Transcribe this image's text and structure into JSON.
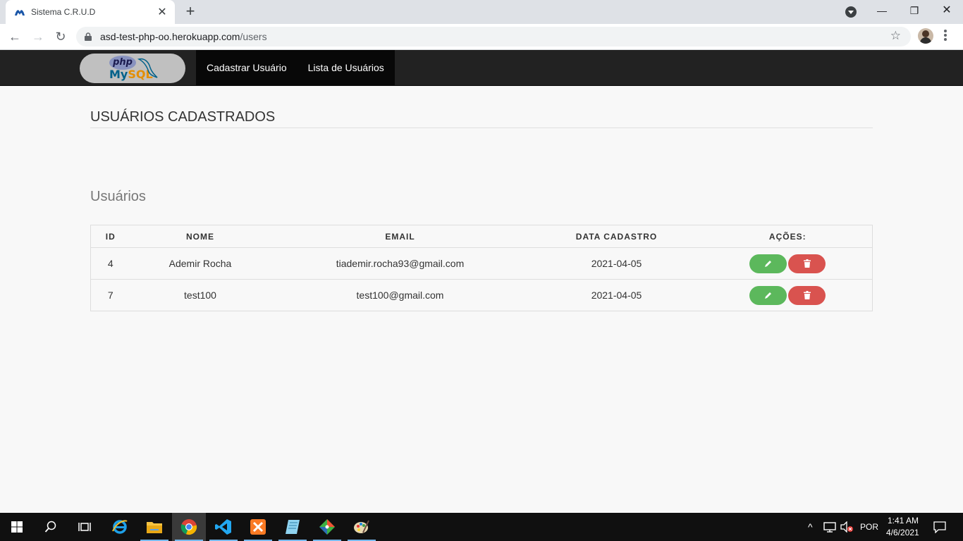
{
  "browser": {
    "tab_title": "Sistema C.R.U.D",
    "url_host": "asd-test-php-oo.herokuapp.com",
    "url_path": "/users"
  },
  "navbar": {
    "logo_php": "php",
    "logo_my": "My",
    "logo_sql": "SQL",
    "links": [
      "Cadastrar Usuário",
      "Lista de Usuários"
    ]
  },
  "page": {
    "header": "USUÁRIOS CADASTRADOS",
    "section_title": "Usuários"
  },
  "table": {
    "columns": [
      "ID",
      "NOME",
      "EMAIL",
      "DATA CADASTRO",
      "AÇÕES:"
    ],
    "rows": [
      {
        "id": "4",
        "nome": "Ademir Rocha",
        "email": "tiademir.rocha93@gmail.com",
        "data": "2021-04-05"
      },
      {
        "id": "7",
        "nome": "test100",
        "email": "test100@gmail.com",
        "data": "2021-04-05"
      }
    ]
  },
  "taskbar": {
    "language": "POR",
    "time": "1:41 AM",
    "date": "4/6/2021"
  },
  "colors": {
    "edit_button": "#5cb85c",
    "delete_button": "#d9534f",
    "navbar": "#222222"
  }
}
